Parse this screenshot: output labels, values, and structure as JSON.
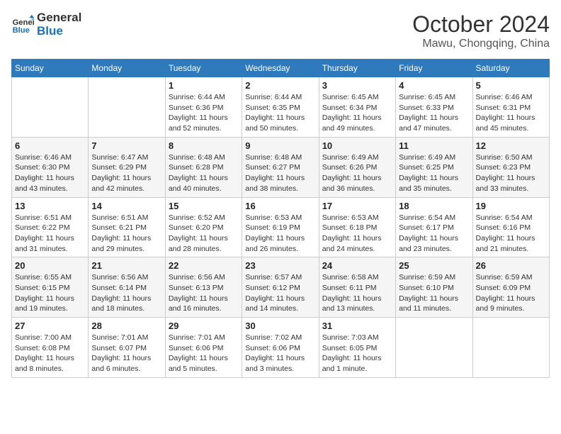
{
  "header": {
    "logo_line1": "General",
    "logo_line2": "Blue",
    "month": "October 2024",
    "location": "Mawu, Chongqing, China"
  },
  "weekdays": [
    "Sunday",
    "Monday",
    "Tuesday",
    "Wednesday",
    "Thursday",
    "Friday",
    "Saturday"
  ],
  "weeks": [
    [
      {
        "day": "",
        "info": ""
      },
      {
        "day": "",
        "info": ""
      },
      {
        "day": "1",
        "info": "Sunrise: 6:44 AM\nSunset: 6:36 PM\nDaylight: 11 hours and 52 minutes."
      },
      {
        "day": "2",
        "info": "Sunrise: 6:44 AM\nSunset: 6:35 PM\nDaylight: 11 hours and 50 minutes."
      },
      {
        "day": "3",
        "info": "Sunrise: 6:45 AM\nSunset: 6:34 PM\nDaylight: 11 hours and 49 minutes."
      },
      {
        "day": "4",
        "info": "Sunrise: 6:45 AM\nSunset: 6:33 PM\nDaylight: 11 hours and 47 minutes."
      },
      {
        "day": "5",
        "info": "Sunrise: 6:46 AM\nSunset: 6:31 PM\nDaylight: 11 hours and 45 minutes."
      }
    ],
    [
      {
        "day": "6",
        "info": "Sunrise: 6:46 AM\nSunset: 6:30 PM\nDaylight: 11 hours and 43 minutes."
      },
      {
        "day": "7",
        "info": "Sunrise: 6:47 AM\nSunset: 6:29 PM\nDaylight: 11 hours and 42 minutes."
      },
      {
        "day": "8",
        "info": "Sunrise: 6:48 AM\nSunset: 6:28 PM\nDaylight: 11 hours and 40 minutes."
      },
      {
        "day": "9",
        "info": "Sunrise: 6:48 AM\nSunset: 6:27 PM\nDaylight: 11 hours and 38 minutes."
      },
      {
        "day": "10",
        "info": "Sunrise: 6:49 AM\nSunset: 6:26 PM\nDaylight: 11 hours and 36 minutes."
      },
      {
        "day": "11",
        "info": "Sunrise: 6:49 AM\nSunset: 6:25 PM\nDaylight: 11 hours and 35 minutes."
      },
      {
        "day": "12",
        "info": "Sunrise: 6:50 AM\nSunset: 6:23 PM\nDaylight: 11 hours and 33 minutes."
      }
    ],
    [
      {
        "day": "13",
        "info": "Sunrise: 6:51 AM\nSunset: 6:22 PM\nDaylight: 11 hours and 31 minutes."
      },
      {
        "day": "14",
        "info": "Sunrise: 6:51 AM\nSunset: 6:21 PM\nDaylight: 11 hours and 29 minutes."
      },
      {
        "day": "15",
        "info": "Sunrise: 6:52 AM\nSunset: 6:20 PM\nDaylight: 11 hours and 28 minutes."
      },
      {
        "day": "16",
        "info": "Sunrise: 6:53 AM\nSunset: 6:19 PM\nDaylight: 11 hours and 26 minutes."
      },
      {
        "day": "17",
        "info": "Sunrise: 6:53 AM\nSunset: 6:18 PM\nDaylight: 11 hours and 24 minutes."
      },
      {
        "day": "18",
        "info": "Sunrise: 6:54 AM\nSunset: 6:17 PM\nDaylight: 11 hours and 23 minutes."
      },
      {
        "day": "19",
        "info": "Sunrise: 6:54 AM\nSunset: 6:16 PM\nDaylight: 11 hours and 21 minutes."
      }
    ],
    [
      {
        "day": "20",
        "info": "Sunrise: 6:55 AM\nSunset: 6:15 PM\nDaylight: 11 hours and 19 minutes."
      },
      {
        "day": "21",
        "info": "Sunrise: 6:56 AM\nSunset: 6:14 PM\nDaylight: 11 hours and 18 minutes."
      },
      {
        "day": "22",
        "info": "Sunrise: 6:56 AM\nSunset: 6:13 PM\nDaylight: 11 hours and 16 minutes."
      },
      {
        "day": "23",
        "info": "Sunrise: 6:57 AM\nSunset: 6:12 PM\nDaylight: 11 hours and 14 minutes."
      },
      {
        "day": "24",
        "info": "Sunrise: 6:58 AM\nSunset: 6:11 PM\nDaylight: 11 hours and 13 minutes."
      },
      {
        "day": "25",
        "info": "Sunrise: 6:59 AM\nSunset: 6:10 PM\nDaylight: 11 hours and 11 minutes."
      },
      {
        "day": "26",
        "info": "Sunrise: 6:59 AM\nSunset: 6:09 PM\nDaylight: 11 hours and 9 minutes."
      }
    ],
    [
      {
        "day": "27",
        "info": "Sunrise: 7:00 AM\nSunset: 6:08 PM\nDaylight: 11 hours and 8 minutes."
      },
      {
        "day": "28",
        "info": "Sunrise: 7:01 AM\nSunset: 6:07 PM\nDaylight: 11 hours and 6 minutes."
      },
      {
        "day": "29",
        "info": "Sunrise: 7:01 AM\nSunset: 6:06 PM\nDaylight: 11 hours and 5 minutes."
      },
      {
        "day": "30",
        "info": "Sunrise: 7:02 AM\nSunset: 6:06 PM\nDaylight: 11 hours and 3 minutes."
      },
      {
        "day": "31",
        "info": "Sunrise: 7:03 AM\nSunset: 6:05 PM\nDaylight: 11 hours and 1 minute."
      },
      {
        "day": "",
        "info": ""
      },
      {
        "day": "",
        "info": ""
      }
    ]
  ]
}
